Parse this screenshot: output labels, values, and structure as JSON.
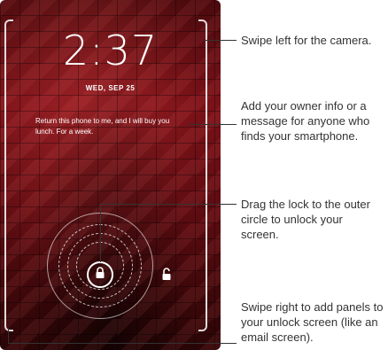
{
  "lock_screen": {
    "time": "2:37",
    "date": "WED, SEP 25",
    "owner_message": "Return this phone to me, and I will buy you lunch. For a week."
  },
  "callouts": {
    "camera": "Swipe left for the camera.",
    "owner_info": "Add your owner info or a message for anyone who finds your smartphone.",
    "drag_lock": "Drag the lock to the outer circle to unlock your screen.",
    "add_panels": "Swipe right to add panels to your unlock screen (like an email screen)."
  },
  "icons": {
    "lock": "lock-icon",
    "unlock": "unlock-icon"
  },
  "colors": {
    "wallpaper": "#7a1218",
    "callout_text": "#333333"
  }
}
